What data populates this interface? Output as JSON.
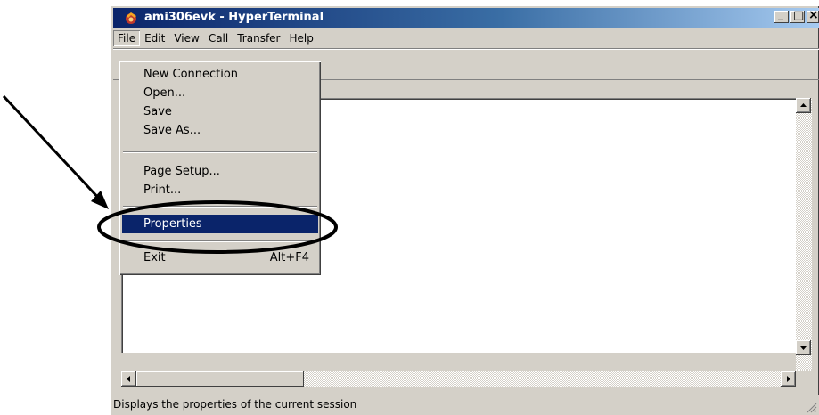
{
  "window": {
    "title": "ami306evk - HyperTerminal",
    "minimize_glyph": "_",
    "maximize_glyph": "□",
    "close_glyph": "×"
  },
  "menubar": {
    "items": [
      "File",
      "Edit",
      "View",
      "Call",
      "Transfer",
      "Help"
    ]
  },
  "file_menu": {
    "items": [
      {
        "label": "New Connection",
        "shortcut": ""
      },
      {
        "label": "Open...",
        "shortcut": ""
      },
      {
        "label": "Save",
        "shortcut": ""
      },
      {
        "label": "Save As...",
        "shortcut": ""
      },
      {
        "label": "Page Setup...",
        "shortcut": ""
      },
      {
        "label": "Print...",
        "shortcut": ""
      },
      {
        "label": "Properties",
        "shortcut": ""
      },
      {
        "label": "Exit",
        "shortcut": "Alt+F4"
      }
    ],
    "selected": "Properties"
  },
  "statusbar": {
    "text": "Displays the properties of the current session"
  },
  "colors": {
    "title_start": "#0a246a",
    "title_end": "#a6caf0",
    "face": "#d4d0c8",
    "highlight": "#0a246a"
  },
  "icons": {
    "app": "hyperterminal-phone-icon",
    "toolbar_properties": "properties-icon",
    "annotation": "arrow-and-ellipse"
  }
}
